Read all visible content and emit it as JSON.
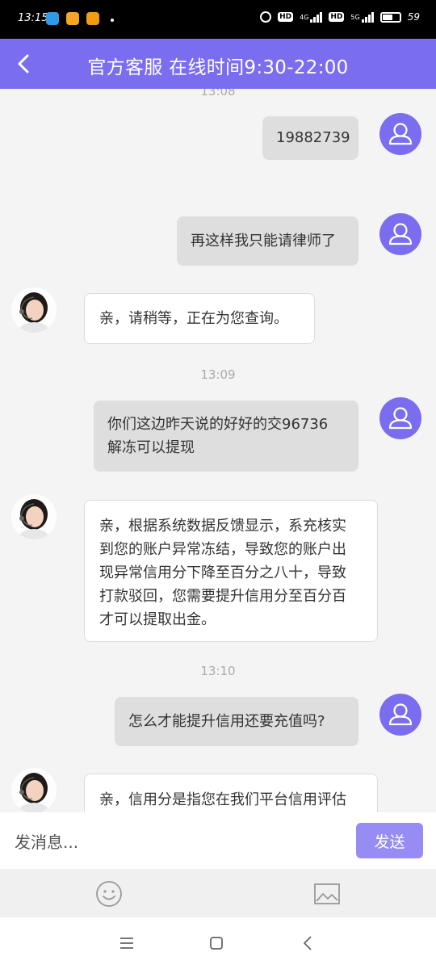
{
  "status_bar": {
    "time": "13:15",
    "network_4g": "4G",
    "network_5g": "5G",
    "hd": "HD",
    "battery_percent": "59",
    "battery_level": 0.59
  },
  "header": {
    "title": "官方客服 在线时间9:30-22:00"
  },
  "messages": [
    {
      "type": "timestamp",
      "text": "13:08"
    },
    {
      "type": "sent",
      "text": "19882739"
    },
    {
      "type": "sent",
      "text": "再这样我只能请律师了"
    },
    {
      "type": "received",
      "text": "亲，请稍等，正在为您查询。"
    },
    {
      "type": "timestamp",
      "text": "13:09"
    },
    {
      "type": "sent",
      "lines": [
        "你们这边昨天说的好好的交96736",
        "解冻可以提现"
      ]
    },
    {
      "type": "received",
      "lines": [
        "亲，根据系统数据反馈显示，系充核实",
        "到您的账户异常冻结，导致您的账户出",
        "现异常信用分下降至百分之八十，导致",
        "打款驳回，您需要提升信用分至百分百",
        "才可以提取出金。"
      ]
    },
    {
      "type": "timestamp",
      "text": "13:10"
    },
    {
      "type": "sent",
      "text": "怎么才能提升信用还要充值吗?"
    },
    {
      "type": "received",
      "text": "亲，信用分是指您在我们平台信用评估"
    }
  ],
  "input": {
    "placeholder": "发消息...",
    "value": "",
    "send_label": "发送"
  },
  "toolbar": {
    "emoji_icon": "smiley-icon",
    "image_icon": "image-icon"
  },
  "nav": {
    "menu_icon": "menu-icon",
    "home_icon": "home-icon",
    "back_icon": "back-icon"
  },
  "colors": {
    "accent": "#7a6df0",
    "send_button": "#978cf3",
    "sent_bubble": "#dedede",
    "received_bubble": "#ffffff"
  }
}
